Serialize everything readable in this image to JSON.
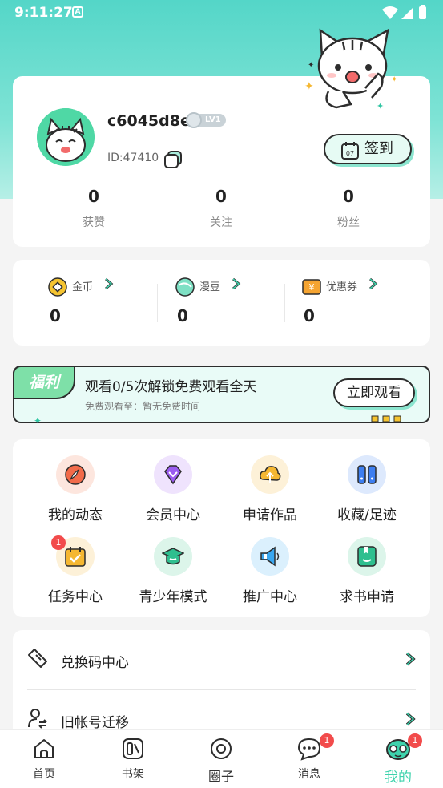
{
  "status_bar": {
    "time": "9:11:27",
    "notification_icon": "A"
  },
  "profile": {
    "username": "c6045d8e",
    "level": "LV1",
    "user_id": "ID:47410",
    "signin_label": "签到",
    "signin_icon_day": "07",
    "stats": [
      {
        "value": "0",
        "label": "获赞"
      },
      {
        "value": "0",
        "label": "关注"
      },
      {
        "value": "0",
        "label": "粉丝"
      }
    ]
  },
  "wallet": [
    {
      "label": "金币",
      "value": "0",
      "icon": "coin-icon"
    },
    {
      "label": "漫豆",
      "value": "0",
      "icon": "bean-icon"
    },
    {
      "label": "优惠券",
      "value": "0",
      "icon": "coupon-icon",
      "icon_text": "¥"
    }
  ],
  "welfare": {
    "tag": "福利",
    "title": "观看0/5次解锁免费观看全天",
    "subtitle": "免费观看至：暂无免费时间",
    "button": "立即观看"
  },
  "features": [
    {
      "label": "我的动态",
      "icon": "compass-icon",
      "color": "#f26b4a"
    },
    {
      "label": "会员中心",
      "icon": "diamond-icon",
      "color": "#9b5cf0"
    },
    {
      "label": "申请作品",
      "icon": "cloud-upload-icon",
      "color": "#f5b731"
    },
    {
      "label": "收藏/足迹",
      "icon": "bookmark-icon",
      "color": "#3d7ef0"
    },
    {
      "label": "任务中心",
      "icon": "task-calendar-icon",
      "color": "#f5b731",
      "badge": "1"
    },
    {
      "label": "青少年模式",
      "icon": "graduation-cap-icon",
      "color": "#2fbf8f"
    },
    {
      "label": "推广中心",
      "icon": "megaphone-icon",
      "color": "#3aa7f0"
    },
    {
      "label": "求书申请",
      "icon": "book-request-icon",
      "color": "#2fbf8f"
    }
  ],
  "list": [
    {
      "label": "兑换码中心",
      "icon": "ticket-icon"
    },
    {
      "label": "旧帐号迁移",
      "icon": "user-transfer-icon"
    }
  ],
  "tabs": [
    {
      "label": "首页",
      "icon": "home-icon"
    },
    {
      "label": "书架",
      "icon": "bookshelf-icon"
    },
    {
      "label": "圈子",
      "icon": "circle-icon"
    },
    {
      "label": "消息",
      "icon": "message-icon",
      "badge": "1"
    },
    {
      "label": "我的",
      "icon": "mine-icon",
      "badge": "1",
      "active": true
    }
  ],
  "colors": {
    "accent": "#3fd3ad",
    "badge": "#f24b4b"
  }
}
